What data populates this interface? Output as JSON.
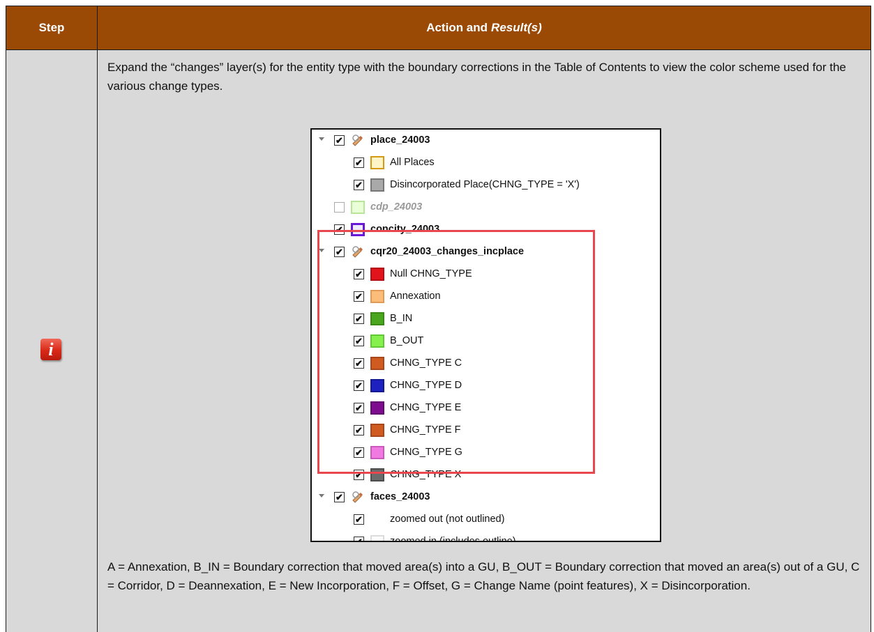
{
  "header": {
    "step_label": "Step",
    "action_label": "Action and",
    "result_label": "Result(s)"
  },
  "step_icon": {
    "glyph": "i",
    "icon": "info-icon",
    "color": "#d92817"
  },
  "intro": "Expand the “changes” layer(s) for the entity type with the boundary corrections in the Table of Contents to view the color scheme used for the various change types.",
  "footer": "A = Annexation, B_IN = Boundary correction that moved area(s) into a GU, B_OUT = Boundary correction that moved an area(s) out of a GU, C = Corridor, D = Deannexation, E = New Incorporation, F = Offset, G = Change Name (point features), X = Disincorporation.",
  "toc": {
    "rows": [
      {
        "label": "place_24003",
        "checked": true,
        "type": "layer"
      },
      {
        "label": "All Places",
        "checked": true,
        "type": "item",
        "fill": "#fff4c8",
        "stroke": "#d59a12"
      },
      {
        "label": "Disincorporated Place(CHNG_TYPE = 'X')",
        "checked": true,
        "type": "item",
        "fill": "#a9a9a9",
        "stroke": "#777777"
      },
      {
        "label": "cdp_24003",
        "checked": false,
        "type": "item-layer",
        "fill": "#eaffd8",
        "stroke": "#b8e59a"
      },
      {
        "label": "concity_24003",
        "checked": true,
        "type": "item-layer",
        "fill": "#f0eaff",
        "stroke": "#6a17d8"
      },
      {
        "label": "cqr20_24003_changes_incplace",
        "checked": true,
        "type": "layer"
      },
      {
        "label": "Null CHNG_TYPE",
        "checked": true,
        "type": "item",
        "fill": "#e1131b",
        "stroke": "#b50f15"
      },
      {
        "label": "Annexation",
        "checked": true,
        "type": "item",
        "fill": "#fcbc7a",
        "stroke": "#e09a56"
      },
      {
        "label": "B_IN",
        "checked": true,
        "type": "item",
        "fill": "#4aa51f",
        "stroke": "#3b8a16"
      },
      {
        "label": "B_OUT",
        "checked": true,
        "type": "item",
        "fill": "#86f04e",
        "stroke": "#62c935"
      },
      {
        "label": "CHNG_TYPE C",
        "checked": true,
        "type": "item",
        "fill": "#cf5b21",
        "stroke": "#a8471a"
      },
      {
        "label": "CHNG_TYPE D",
        "checked": true,
        "type": "item",
        "fill": "#1c21bf",
        "stroke": "#151893"
      },
      {
        "label": "CHNG_TYPE E",
        "checked": true,
        "type": "item",
        "fill": "#7d0d8e",
        "stroke": "#600a6d"
      },
      {
        "label": "CHNG_TYPE F",
        "checked": true,
        "type": "item",
        "fill": "#cf5b21",
        "stroke": "#a8471a"
      },
      {
        "label": "CHNG_TYPE G",
        "checked": true,
        "type": "item",
        "fill": "#f07ae2",
        "stroke": "#c95abb"
      },
      {
        "label": "CHNG_TYPE X",
        "checked": true,
        "type": "item",
        "fill": "#6b6b6b",
        "stroke": "#4d4d4d"
      },
      {
        "label": "faces_24003",
        "checked": true,
        "type": "layer"
      },
      {
        "label": "zoomed out (not outlined)",
        "checked": true,
        "type": "item",
        "fill": "#ffffff",
        "stroke": "#ffffff"
      },
      {
        "label": "zoomed in (includes outline)",
        "checked": true,
        "type": "item",
        "fill": "#ffffff",
        "stroke": "#dcdcdc"
      }
    ],
    "highlight_color": "#e8484d"
  },
  "colors": {
    "header_bg": "#9a4a05",
    "body_bg": "#d9d9d9"
  }
}
